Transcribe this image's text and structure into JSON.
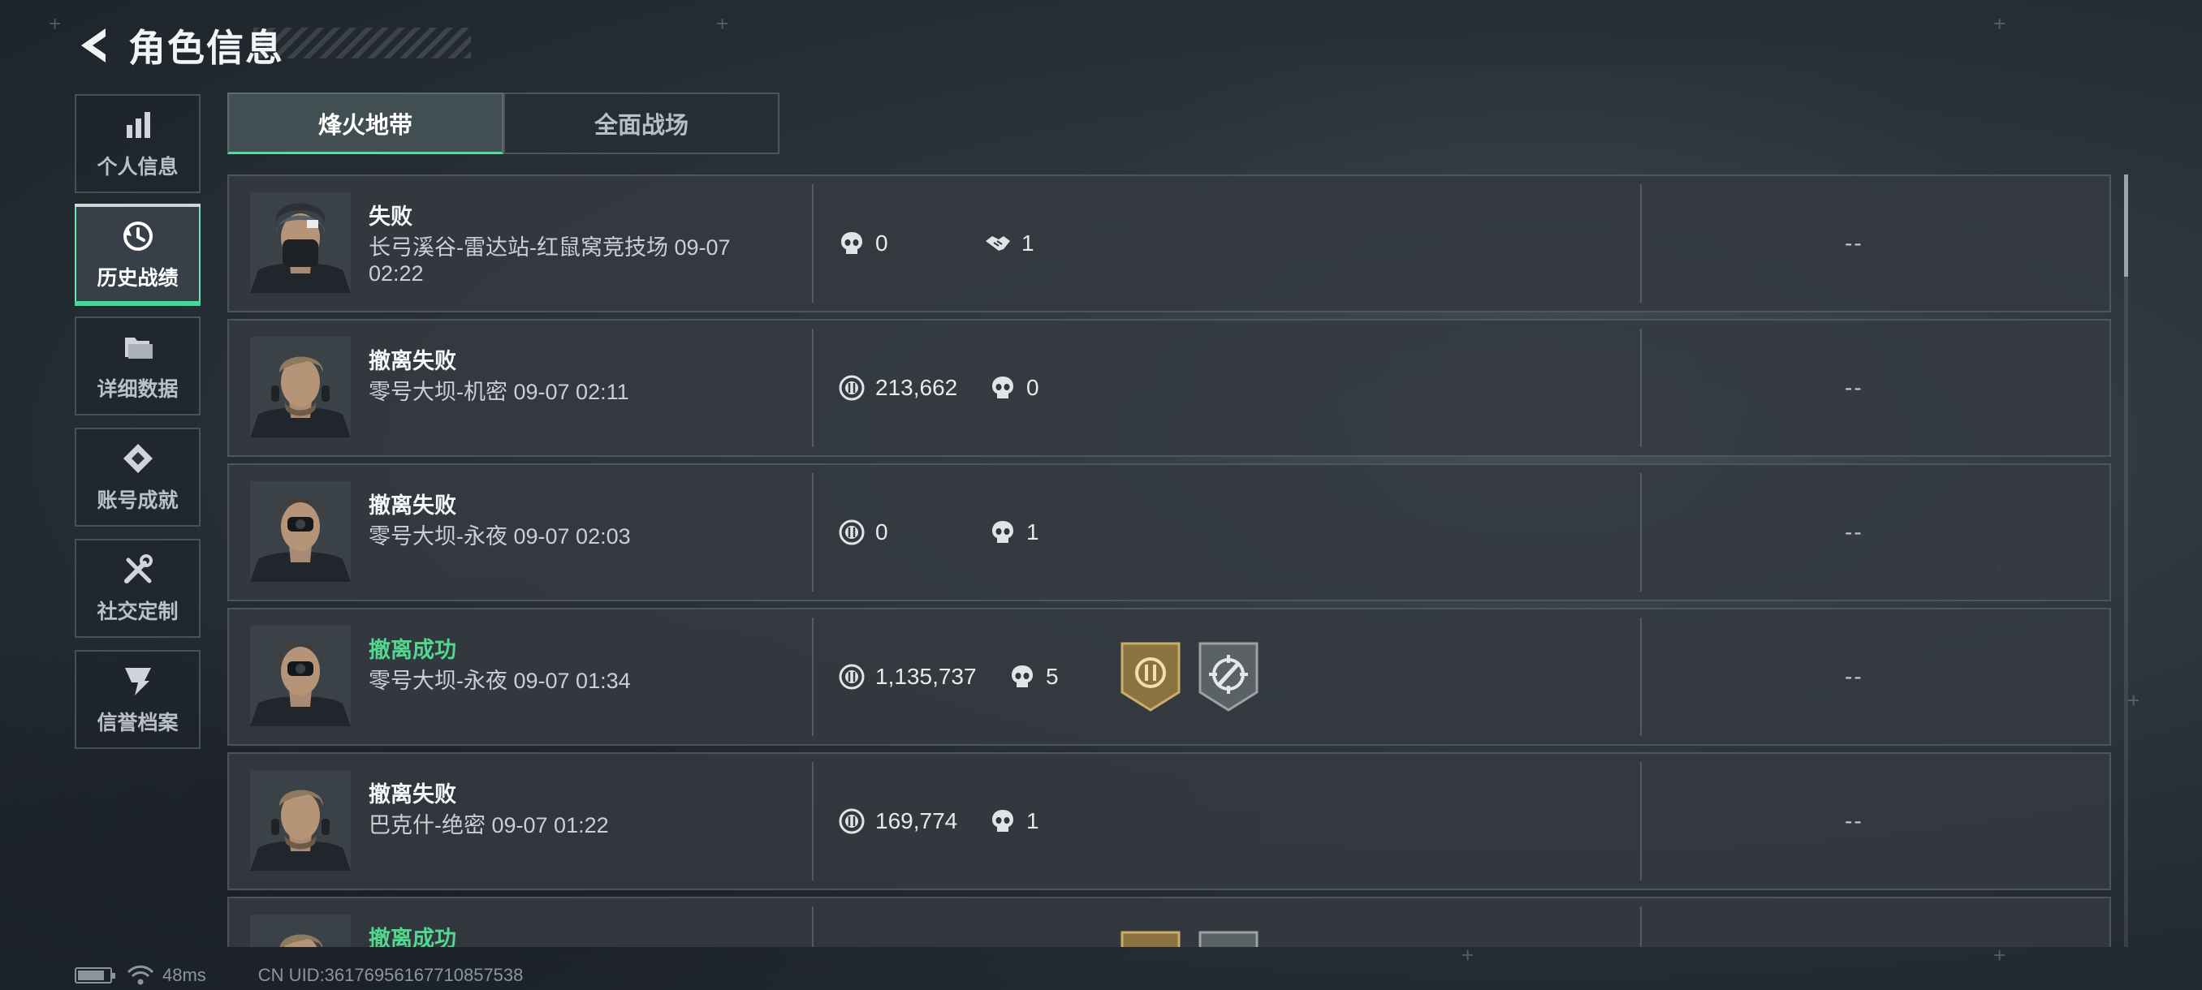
{
  "header": {
    "title": "角色信息",
    "back_icon": "chevron-left-icon"
  },
  "sidebar": {
    "items": [
      {
        "label": "个人信息",
        "icon": "bar-chart-icon",
        "active": false
      },
      {
        "label": "历史战绩",
        "icon": "history-icon",
        "active": true
      },
      {
        "label": "详细数据",
        "icon": "folder-icon",
        "active": false
      },
      {
        "label": "账号成就",
        "icon": "achievement-icon",
        "active": false
      },
      {
        "label": "社交定制",
        "icon": "tools-icon",
        "active": false
      },
      {
        "label": "信誉档案",
        "icon": "credit-shield-icon",
        "active": false
      }
    ]
  },
  "tabs": [
    {
      "label": "烽火地带",
      "active": true
    },
    {
      "label": "全面战场",
      "active": false
    }
  ],
  "matches": [
    {
      "result": "失败",
      "status": "fail",
      "detail": "长弓溪谷-雷达站-红鼠窝竞技场 09-07 02:22",
      "stats": [
        {
          "icon": "skull-icon",
          "value": "0"
        },
        {
          "icon": "handshake-icon",
          "value": "1"
        }
      ],
      "badges": [],
      "extra": "--"
    },
    {
      "result": "撤离失败",
      "status": "fail",
      "detail": "零号大坝-机密 09-07 02:11",
      "stats": [
        {
          "icon": "coin-icon",
          "value": "213,662"
        },
        {
          "icon": "skull-icon",
          "value": "0"
        }
      ],
      "badges": [],
      "extra": "--"
    },
    {
      "result": "撤离失败",
      "status": "fail",
      "detail": "零号大坝-永夜 09-07 02:03",
      "stats": [
        {
          "icon": "coin-icon",
          "value": "0"
        },
        {
          "icon": "skull-icon",
          "value": "1"
        }
      ],
      "badges": [],
      "extra": "--"
    },
    {
      "result": "撤离成功",
      "status": "success",
      "detail": "零号大坝-永夜 09-07 01:34",
      "stats": [
        {
          "icon": "coin-icon",
          "value": "1,135,737"
        },
        {
          "icon": "skull-icon",
          "value": "5"
        }
      ],
      "badges": [
        "gold-coin-badge-icon",
        "crosshair-badge-icon"
      ],
      "extra": "--"
    },
    {
      "result": "撤离失败",
      "status": "fail",
      "detail": "巴克什-绝密 09-07 01:22",
      "stats": [
        {
          "icon": "coin-icon",
          "value": "169,774"
        },
        {
          "icon": "skull-icon",
          "value": "1"
        }
      ],
      "badges": [],
      "extra": "--"
    },
    {
      "result": "撤离成功",
      "status": "success",
      "detail": "",
      "stats": [],
      "badges": [
        "gold-coin-badge-icon",
        "grey-badge-icon"
      ],
      "extra": ""
    }
  ],
  "footer": {
    "ping": "48ms",
    "uid": "CN UID:36176956167710857538"
  },
  "colors": {
    "accent": "#3fdc96",
    "success": "#52d78f",
    "panel": "#343a40"
  }
}
